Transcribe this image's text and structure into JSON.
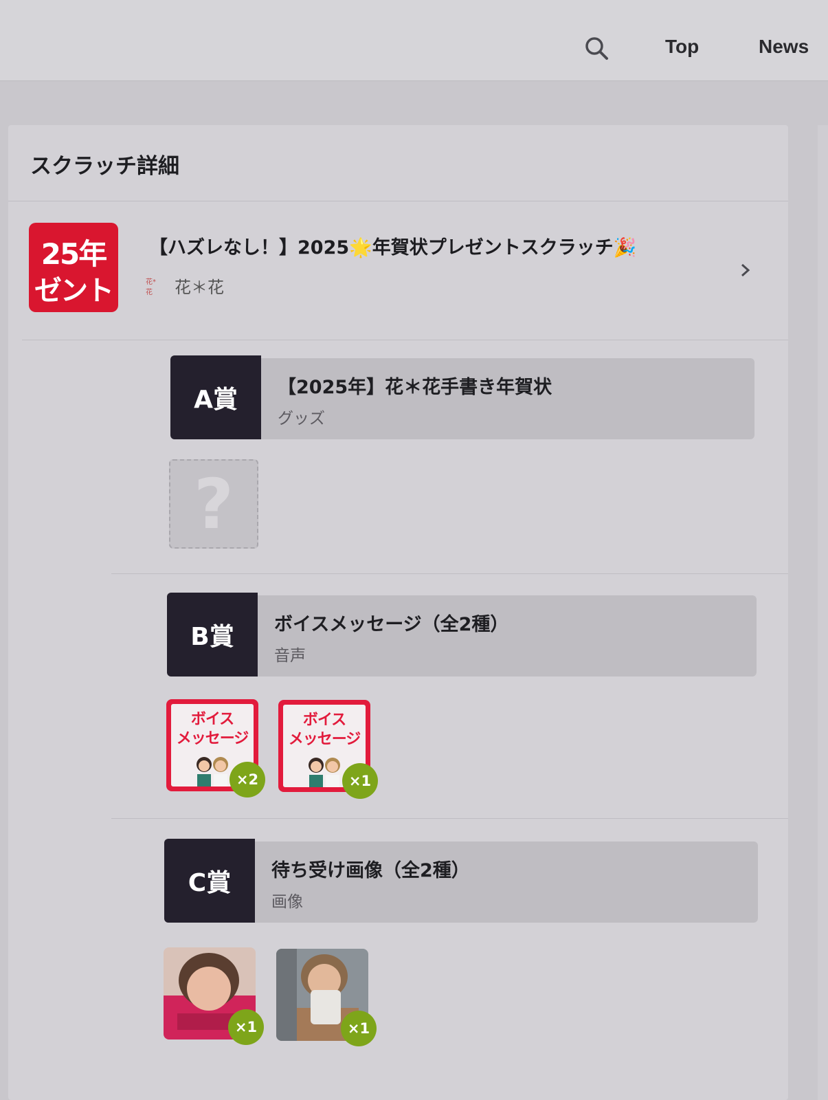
{
  "header": {
    "nav": [
      "Top",
      "News"
    ]
  },
  "page": {
    "title": "スクラッチ詳細"
  },
  "scratch": {
    "title": "【ハズレなし！】2025🌟年賀状プレゼントスクラッチ🎉",
    "thumb_line1": "25年",
    "thumb_line2": "ゼント",
    "author_logo": "花*花",
    "author": "花＊花"
  },
  "prizes": [
    {
      "rank": "A賞",
      "name": "【2025年】花＊花手書き年賀状",
      "type": "グッズ",
      "items": [
        {
          "placeholder": "?"
        }
      ]
    },
    {
      "rank": "B賞",
      "name": "ボイスメッセージ（全2種）",
      "type": "音声",
      "items": [
        {
          "line1": "ボイス",
          "line2": "メッセージ",
          "count": "×2"
        },
        {
          "line1": "ボイス",
          "line2": "メッセージ",
          "count": "×1"
        }
      ]
    },
    {
      "rank": "C賞",
      "name": "待ち受け画像（全2種）",
      "type": "画像",
      "items": [
        {
          "count": "×1"
        },
        {
          "count": "×1"
        }
      ]
    }
  ],
  "colors": {
    "accent_red": "#e21b3c",
    "badge_dark": "#24202d",
    "count_green": "#7ea51a"
  },
  "icons": [
    "search-icon",
    "chevron-right-icon"
  ]
}
